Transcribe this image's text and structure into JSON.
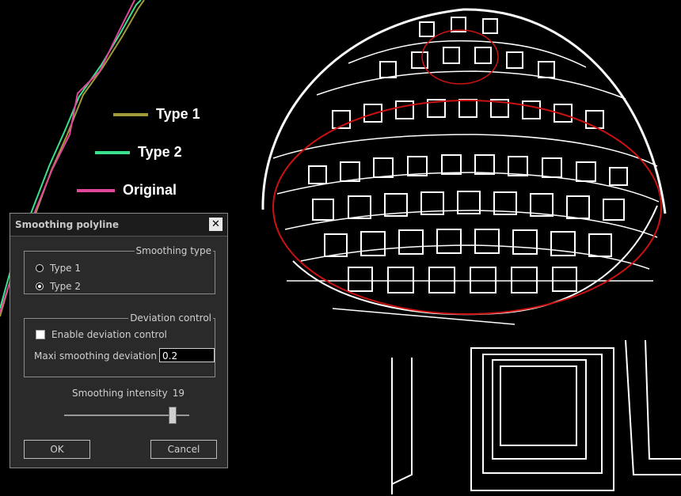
{
  "legend": [
    {
      "label": "Type 1",
      "color": "#a09a3a"
    },
    {
      "label": "Type 2",
      "color": "#39e18c"
    },
    {
      "label": "Original",
      "color": "#e2469a"
    }
  ],
  "dialog": {
    "title": "Smoothing polyline",
    "close_icon": "close-icon",
    "smoothing_type": {
      "legend": "Smoothing type",
      "options": [
        {
          "label": "Type 1",
          "selected": false
        },
        {
          "label": "Type 2",
          "selected": true
        }
      ]
    },
    "deviation": {
      "legend": "Deviation control",
      "enable_label": "Enable deviation control",
      "enabled": false,
      "max_label": "Maxi smoothing deviation :",
      "max_value": "0.2"
    },
    "intensity": {
      "label": "Smoothing intensity",
      "value": "19"
    },
    "ok_label": "OK",
    "cancel_label": "Cancel"
  },
  "colors": {
    "background": "#000000",
    "selection_ellipse": "#cc1111"
  }
}
